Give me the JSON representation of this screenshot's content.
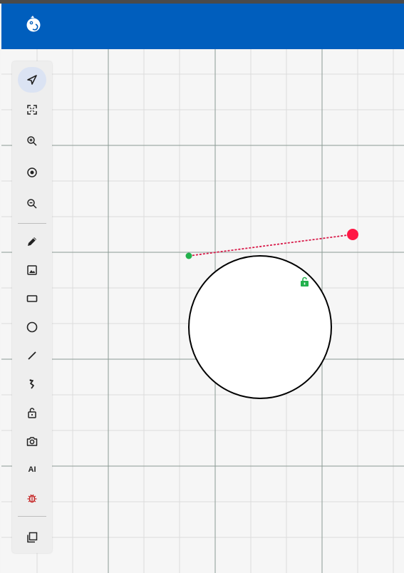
{
  "app": {
    "header_color": "#005ebd",
    "logo_icon": "chameleon-logo-icon"
  },
  "toolbar": {
    "tools": [
      {
        "name": "select-tool",
        "icon": "cursor-arrow-icon",
        "active": true
      },
      {
        "name": "fit-view-tool",
        "icon": "fullscreen-icon"
      },
      {
        "name": "zoom-in-tool",
        "icon": "zoom-in-icon"
      },
      {
        "name": "center-view-tool",
        "icon": "target-icon"
      },
      {
        "name": "zoom-out-tool",
        "icon": "zoom-out-icon"
      },
      {
        "name": "pencil-tool",
        "icon": "pencil-icon"
      },
      {
        "name": "image-tool",
        "icon": "image-icon"
      },
      {
        "name": "rectangle-tool",
        "icon": "rectangle-icon"
      },
      {
        "name": "circle-tool",
        "icon": "circle-icon"
      },
      {
        "name": "line-tool",
        "icon": "line-icon"
      },
      {
        "name": "arrow-tool",
        "icon": "curved-arrow-icon"
      },
      {
        "name": "lock-tool",
        "icon": "lock-open-icon"
      },
      {
        "name": "screenshot-tool",
        "icon": "camera-icon"
      },
      {
        "name": "ai-tool",
        "icon": "ai-text-icon",
        "label": "AI"
      },
      {
        "name": "debug-tool",
        "icon": "bug-icon",
        "color": "#c62828"
      },
      {
        "name": "duplicate-tool",
        "icon": "copy-icon"
      }
    ]
  },
  "canvas": {
    "grid_minor_color": "#dcdcdc",
    "grid_major_color": "#8a9a94",
    "shapes": [
      {
        "type": "circle",
        "stroke": "#000000",
        "fill": "#ffffff"
      },
      {
        "type": "dashed-line",
        "stroke": "#d81b4a",
        "start_handle_color": "#22b14c",
        "end_handle_color": "#ff1744"
      },
      {
        "type": "lock-indicator",
        "icon": "lock-open-icon",
        "color": "#22b14c"
      }
    ]
  }
}
